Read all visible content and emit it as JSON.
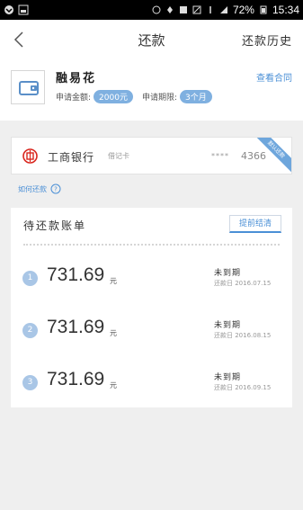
{
  "statusbar": {
    "battery": "72%",
    "time": "15:34"
  },
  "nav": {
    "title": "还款",
    "history": "还款历史"
  },
  "product": {
    "name": "融易花",
    "contract": "查看合同",
    "amount_label": "申请金额:",
    "amount_value": "2000元",
    "term_label": "申请期限:",
    "term_value": "3个月"
  },
  "bank": {
    "name": "工商银行",
    "type": "借记卡",
    "mask": "****",
    "last4": "4366",
    "ribbon": "默认还款"
  },
  "help": {
    "label": "如何还款"
  },
  "bill": {
    "title": "待还款账单",
    "early_button": "提前结清",
    "rows": [
      {
        "index": "1",
        "amount": "731.69",
        "unit": "元",
        "status": "未到期",
        "due": "还款日 2016.07.15"
      },
      {
        "index": "2",
        "amount": "731.69",
        "unit": "元",
        "status": "未到期",
        "due": "还款日 2016.08.15"
      },
      {
        "index": "3",
        "amount": "731.69",
        "unit": "元",
        "status": "未到期",
        "due": "还款日 2016.09.15"
      }
    ]
  },
  "colors": {
    "accent": "#4a8fd6",
    "pill": "#7fb0e0",
    "index_circle": "#a9c6e6",
    "bank_red": "#d9251d"
  }
}
